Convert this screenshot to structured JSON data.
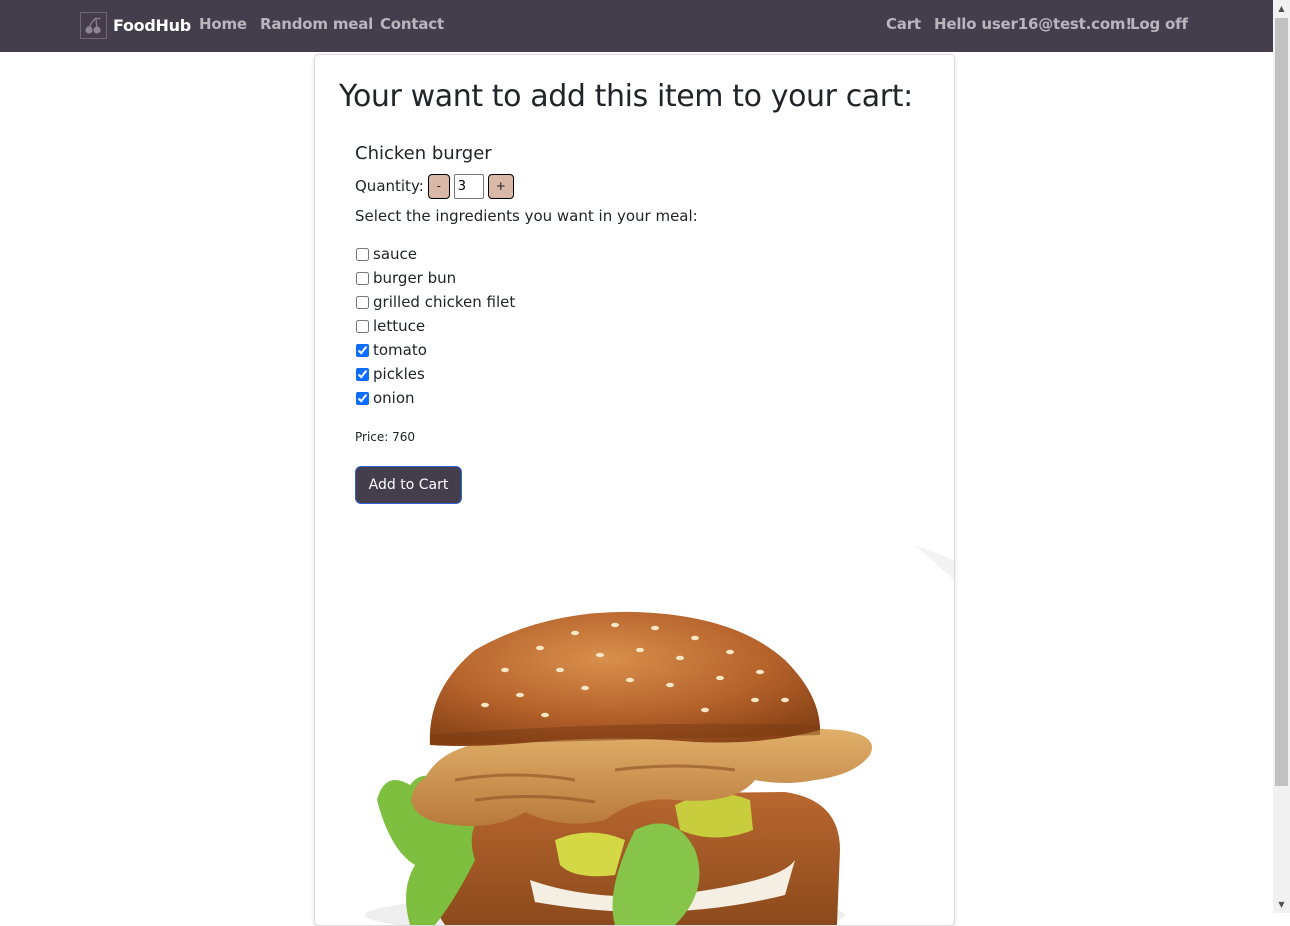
{
  "navbar": {
    "brand": "FoodHub",
    "links": [
      "Home",
      "Random meal",
      "Contact"
    ],
    "right": [
      "Cart",
      "Hello user16@test.com!",
      "Log off"
    ]
  },
  "page": {
    "heading": "Your want to add this item to your cart:",
    "item_name": "Chicken burger",
    "quantity_label": "Quantity:",
    "minus_label": "-",
    "quantity_value": "3",
    "plus_label": "+",
    "select_label": "Select the ingredients you want in your meal:",
    "ingredients": [
      {
        "name": "sauce",
        "checked": false
      },
      {
        "name": "burger bun",
        "checked": false
      },
      {
        "name": "grilled chicken filet",
        "checked": false
      },
      {
        "name": "lettuce",
        "checked": false
      },
      {
        "name": "tomato",
        "checked": true
      },
      {
        "name": "pickles",
        "checked": true
      },
      {
        "name": "onion",
        "checked": true
      }
    ],
    "price_text": "Price: 760",
    "add_button": "Add to Cart"
  },
  "icons": {
    "logo": "cherry-logo-icon",
    "scroll_up": "scroll-up-arrow-icon",
    "scroll_down": "scroll-down-arrow-icon"
  }
}
